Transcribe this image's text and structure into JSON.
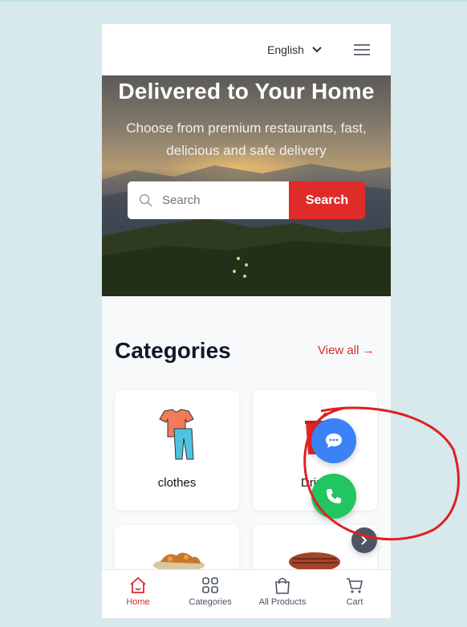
{
  "header": {
    "language": "English"
  },
  "hero": {
    "title": "Delivered to Your Home",
    "subtitle": "Choose from premium restaurants, fast, delicious and safe delivery",
    "search_placeholder": "Search",
    "search_button": "Search"
  },
  "categories": {
    "title": "Categories",
    "view_all": "View all →",
    "items": [
      {
        "label": "clothes",
        "icon": "clothes-icon"
      },
      {
        "label": "Drink",
        "icon": "drink-icon"
      },
      {
        "label": "",
        "icon": "fried-food-icon"
      },
      {
        "label": "",
        "icon": "steak-icon"
      }
    ]
  },
  "fabs": {
    "chat": "chat-icon",
    "phone": "phone-icon",
    "next": "chevron-right-icon"
  },
  "bottom_nav": [
    {
      "label": "Home",
      "icon": "home-icon",
      "active": true
    },
    {
      "label": "Categories",
      "icon": "grid-icon",
      "active": false
    },
    {
      "label": "All Products",
      "icon": "shopping-bag-icon",
      "active": false
    },
    {
      "label": "Cart",
      "icon": "cart-icon",
      "active": false
    }
  ],
  "colors": {
    "accent": "#e02b2b",
    "chat_fab": "#3b82f6",
    "phone_fab": "#22c55e",
    "annotation": "#e02020"
  }
}
